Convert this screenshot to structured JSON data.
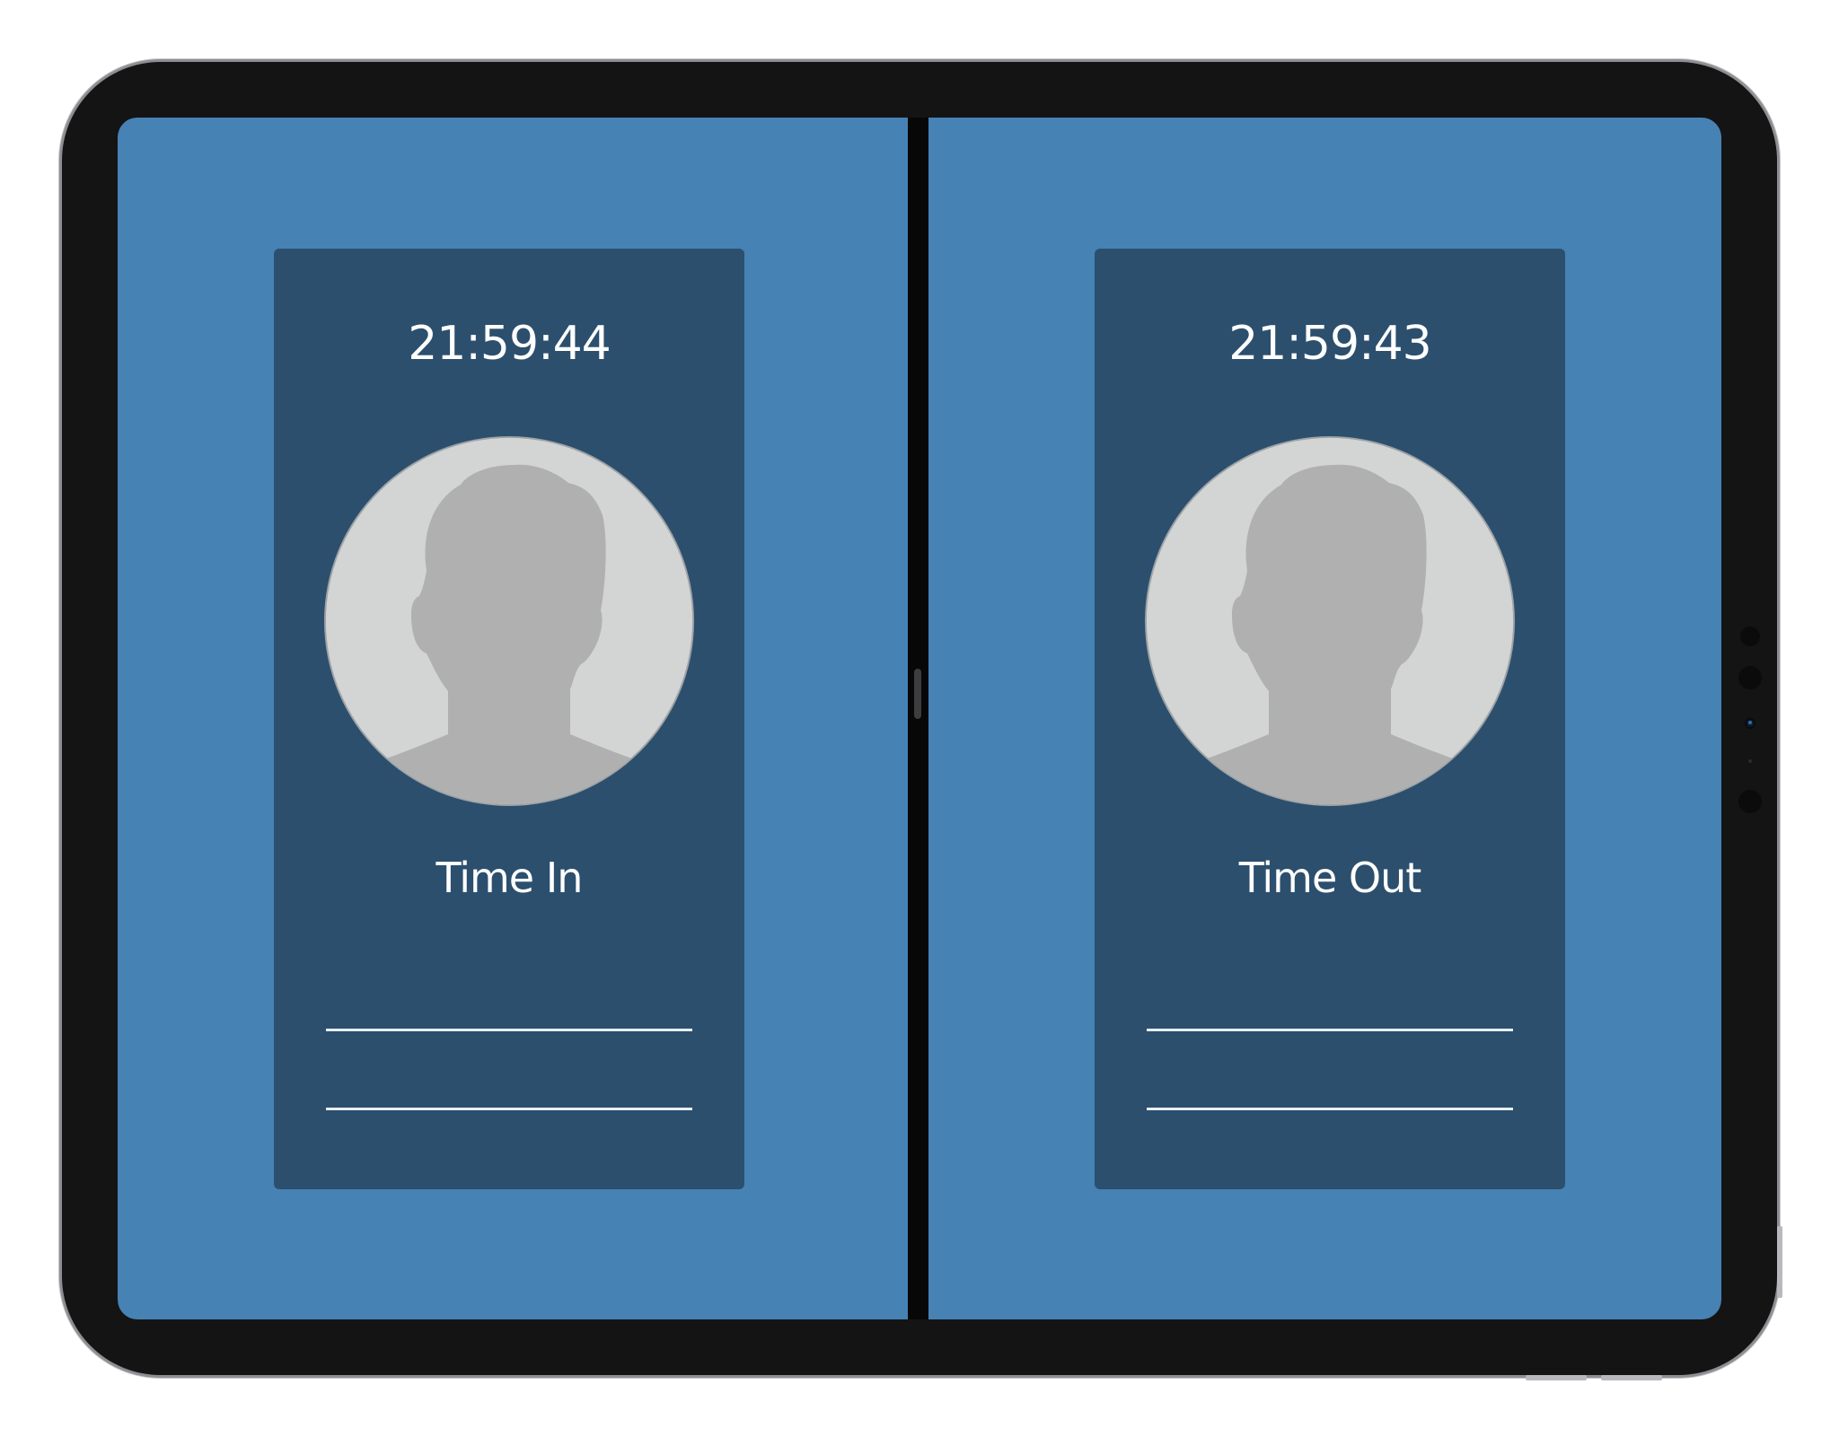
{
  "colors": {
    "screen_background": "#4682b4",
    "card_background": "#2c4f6e",
    "text": "#ffffff",
    "avatar_background": "#d3d4d4",
    "avatar_silhouette": "#afb0af",
    "device_bezel": "#141414"
  },
  "left_panel": {
    "clock": "21:59:44",
    "avatar_icon": "person-silhouette-icon",
    "action_label": "Time In",
    "fields": [
      "",
      ""
    ]
  },
  "right_panel": {
    "clock": "21:59:43",
    "avatar_icon": "person-silhouette-icon",
    "action_label": "Time Out",
    "fields": [
      "",
      ""
    ]
  }
}
